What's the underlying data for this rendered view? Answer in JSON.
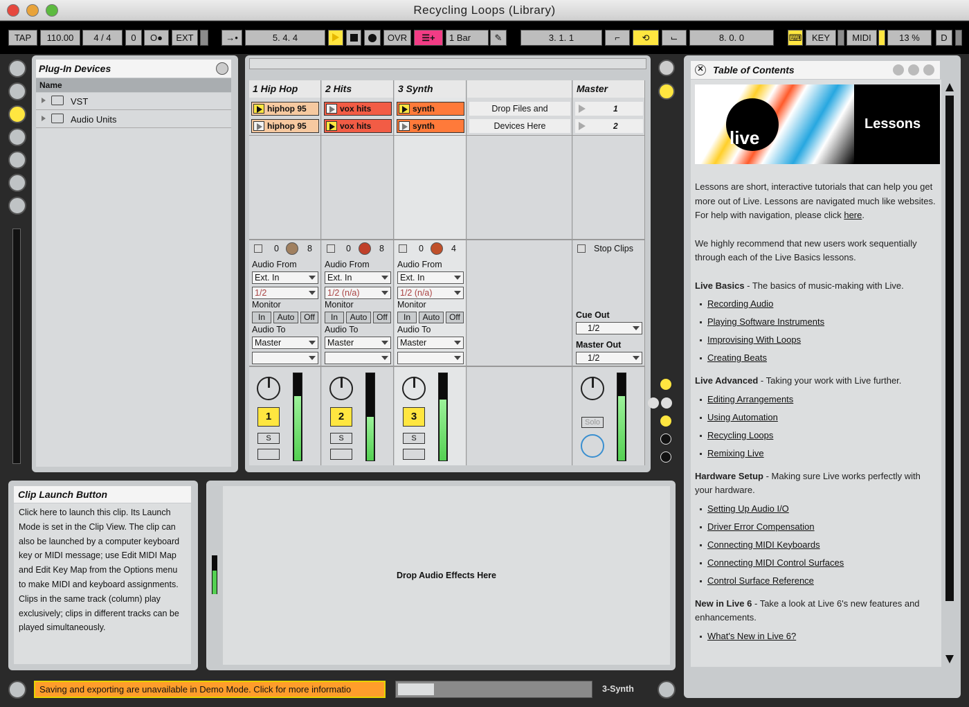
{
  "window": {
    "title": "Recycling Loops (Library)"
  },
  "control_bar": {
    "tap": "TAP",
    "tempo": "110.00",
    "time_sig": "4 / 4",
    "zero": "0",
    "metro": "O●",
    "ext": "EXT",
    "follow": "→•",
    "arrangement_pos": "5.   4.   4",
    "ovr": "OVR",
    "quantize": "1 Bar",
    "loop_start": "3.   1.   1",
    "loop_length": "8.   0.   0",
    "key": "KEY",
    "midi": "MIDI",
    "cpu": "13 %",
    "d": "D"
  },
  "browser": {
    "title": "Plug-In Devices",
    "column": "Name",
    "items": [
      {
        "label": "VST"
      },
      {
        "label": "Audio Units"
      }
    ]
  },
  "session": {
    "tracks": [
      {
        "name": "1 Hip Hop",
        "clips": [
          "hiphop 95",
          "hiphop 95"
        ],
        "left": "0",
        "right": "8",
        "audio_from": "Audio From",
        "input": "Ext. In",
        "channel": "1/2",
        "monitor": "Monitor",
        "audio_to": "Audio To",
        "output": "Master",
        "number": "1",
        "solo": "S"
      },
      {
        "name": "2 Hits",
        "clips": [
          "vox hits",
          "vox hits"
        ],
        "left": "0",
        "right": "8",
        "audio_from": "Audio From",
        "input": "Ext. In",
        "channel": "1/2 (n/a)",
        "monitor": "Monitor",
        "audio_to": "Audio To",
        "output": "Master",
        "number": "2",
        "solo": "S"
      },
      {
        "name": "3 Synth",
        "clips": [
          "synth",
          "synth"
        ],
        "left": "0",
        "right": "4",
        "audio_from": "Audio From",
        "input": "Ext. In",
        "channel": "1/2 (n/a)",
        "monitor": "Monitor",
        "audio_to": "Audio To",
        "output": "Master",
        "number": "3",
        "solo": "S"
      }
    ],
    "monitor_buttons": [
      "In",
      "Auto",
      "Off"
    ],
    "drop_text_1": "Drop Files and",
    "drop_text_2": "Devices Here",
    "master": {
      "name": "Master",
      "scenes": [
        "1",
        "2"
      ],
      "stop_clips": "Stop Clips",
      "cue_out": "Cue Out",
      "cue_value": "1/2",
      "master_out": "Master Out",
      "master_value": "1/2",
      "solo": "Solo"
    }
  },
  "info": {
    "title": "Clip Launch Button",
    "body": "Click here to launch this clip. Its Launch Mode is set in the Clip View. The clip can also be launched by a computer keyboard key or MIDI message; use Edit MIDI Map and Edit Key Map from the Options menu to make MIDI and keyboard assignments. Clips in the same track (column) play exclusively; clips in different tracks can be played simultaneously."
  },
  "device_view": {
    "drop_text": "Drop Audio Effects Here"
  },
  "status_bar": {
    "message": "Saving and exporting are unavailable in Demo Mode. Click for more informatio",
    "track": "3-Synth"
  },
  "toc": {
    "title": "Table of Contents",
    "banner_logo": "live",
    "banner_text": "Lessons",
    "intro_1": "Lessons are short, interactive tutorials that can help you get more out of Live. Lessons are navigated much like websites. For help with navigation, please click ",
    "intro_link": "here",
    "intro_2": "We highly recommend that new users work sequentially through each of the Live Basics lessons.",
    "sections": [
      {
        "head": "Live Basics",
        "desc": " - The basics of music-making with Live.",
        "links": [
          "Recording Audio",
          "Playing Software Instruments",
          "Improvising With Loops",
          "Creating Beats"
        ]
      },
      {
        "head": "Live Advanced",
        "desc": " - Taking your work with Live further.",
        "links": [
          "Editing Arrangements",
          "Using Automation",
          "Recycling Loops",
          "Remixing Live"
        ]
      },
      {
        "head": "Hardware Setup",
        "desc": " - Making sure Live works perfectly with your hardware.",
        "links": [
          "Setting Up Audio I/O",
          "Driver Error Compensation",
          "Connecting MIDI Keyboards",
          "Connecting MIDI Control Surfaces",
          "Control Surface Reference"
        ]
      },
      {
        "head": "New in Live 6",
        "desc": " - Take a look at Live 6's new features and enhancements.",
        "links": [
          "What's New in Live 6?"
        ]
      }
    ]
  },
  "colors": {
    "accent_yellow": "#ffe640",
    "clip_peach": "#f6c9a0",
    "clip_red": "#f25c45",
    "clip_orange": "#ff7a3a",
    "demo_orange": "#ff9d2b"
  }
}
